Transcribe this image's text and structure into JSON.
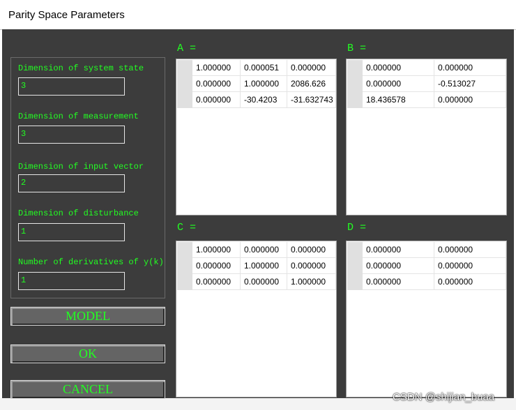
{
  "window": {
    "title": "Parity Space Parameters"
  },
  "fields": [
    {
      "label": "Dimension of system state",
      "value": "3"
    },
    {
      "label": "Dimension of measurement",
      "value": "3"
    },
    {
      "label": "Dimension of input vector",
      "value": "2"
    },
    {
      "label": "Dimension of disturbance",
      "value": "1"
    },
    {
      "label": "Number of derivatives of y(k)",
      "value": "1"
    }
  ],
  "buttons": {
    "model": "MODEL",
    "ok": "OK",
    "cancel": "CANCEL"
  },
  "matrices": {
    "A": {
      "label": "A =",
      "rows": [
        [
          "1.000000",
          "0.000051",
          "0.000000"
        ],
        [
          "0.000000",
          "1.000000",
          "2086.626"
        ],
        [
          "0.000000",
          "-30.4203",
          "-31.632743"
        ]
      ]
    },
    "B": {
      "label": "B =",
      "rows": [
        [
          "0.000000",
          "0.000000"
        ],
        [
          "0.000000",
          "-0.513027"
        ],
        [
          "18.436578",
          "0.000000"
        ]
      ]
    },
    "C": {
      "label": "C =",
      "rows": [
        [
          "1.000000",
          "0.000000",
          "0.000000"
        ],
        [
          "0.000000",
          "1.000000",
          "0.000000"
        ],
        [
          "0.000000",
          "0.000000",
          "1.000000"
        ]
      ]
    },
    "D": {
      "label": "D =",
      "rows": [
        [
          "0.000000",
          "0.000000"
        ],
        [
          "0.000000",
          "0.000000"
        ],
        [
          "0.000000",
          "0.000000"
        ]
      ]
    }
  },
  "watermark": "CSDN @shijian_buaa",
  "colors": {
    "dialog_background": "#3c3c3c",
    "label_text": "#22ff22",
    "button_face": "#646464"
  }
}
